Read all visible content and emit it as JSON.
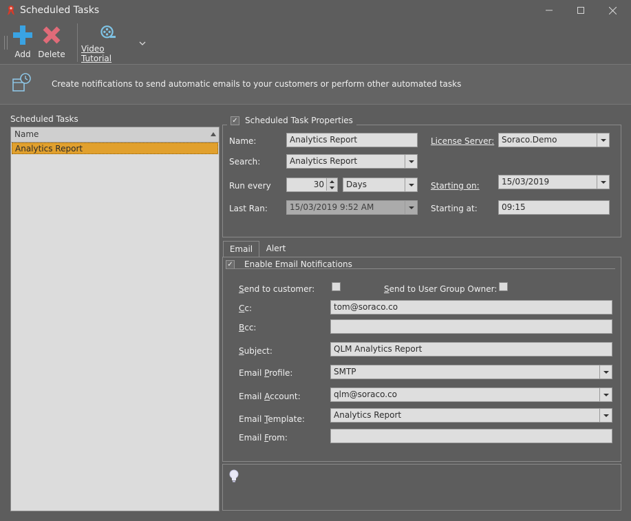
{
  "window": {
    "title": "Scheduled Tasks",
    "app_icon": "app-ribbon-icon"
  },
  "toolbar": {
    "add_label": "Add",
    "delete_label": "Delete",
    "video_label": "Video Tutorial",
    "add_icon": "plus-icon",
    "delete_icon": "x-icon",
    "video_icon": "film-reel-icon"
  },
  "banner": {
    "text": "Create notifications to send automatic emails to your customers or perform other automated tasks",
    "icon": "scheduled-task-icon"
  },
  "task_list": {
    "heading": "Scheduled Tasks",
    "column_header": "Name",
    "rows": [
      {
        "name": "Analytics Report",
        "selected": true
      }
    ]
  },
  "properties": {
    "title": "Scheduled Task Properties",
    "enabled": true,
    "name_label": "Name:",
    "name_value": "Analytics Report",
    "search_label": "Search:",
    "search_value": "Analytics Report",
    "run_every_label": "Run every",
    "run_every_value": "30",
    "run_every_unit": "Days",
    "last_ran_label": "Last Ran:",
    "last_ran_value": "15/03/2019 9:52 AM",
    "license_server_label": "License Server:",
    "license_server_value": "Soraco.Demo",
    "starting_on_label": "Starting on:",
    "starting_on_value": "15/03/2019",
    "starting_at_label": "Starting at:",
    "starting_at_value": "09:15"
  },
  "tabs": [
    {
      "label": "Email",
      "active": true
    },
    {
      "label": "Alert",
      "active": false
    }
  ],
  "email": {
    "enable_label": "Enable Email Notifications",
    "enabled": true,
    "send_to_customer_label": "Send to customer:",
    "send_to_customer": false,
    "send_to_owner_label": "Send to User Group Owner:",
    "send_to_owner": false,
    "cc_label": "Cc:",
    "cc_value": "tom@soraco.co",
    "bcc_label": "Bcc:",
    "bcc_value": "",
    "subject_label": "Subject:",
    "subject_value": "QLM Analytics Report",
    "profile_label": "Email Profile:",
    "profile_value": "SMTP",
    "account_label": "Email Account:",
    "account_value": "qlm@soraco.co",
    "template_label": "Email Template:",
    "template_value": "Analytics Report",
    "from_label": "Email From:",
    "from_value": ""
  },
  "hint": {
    "icon": "lightbulb-icon"
  },
  "colors": {
    "background": "#5d5d5d",
    "selection": "#e1a02d",
    "add_icon": "#3aa3e3",
    "delete_icon": "#e06b78"
  }
}
